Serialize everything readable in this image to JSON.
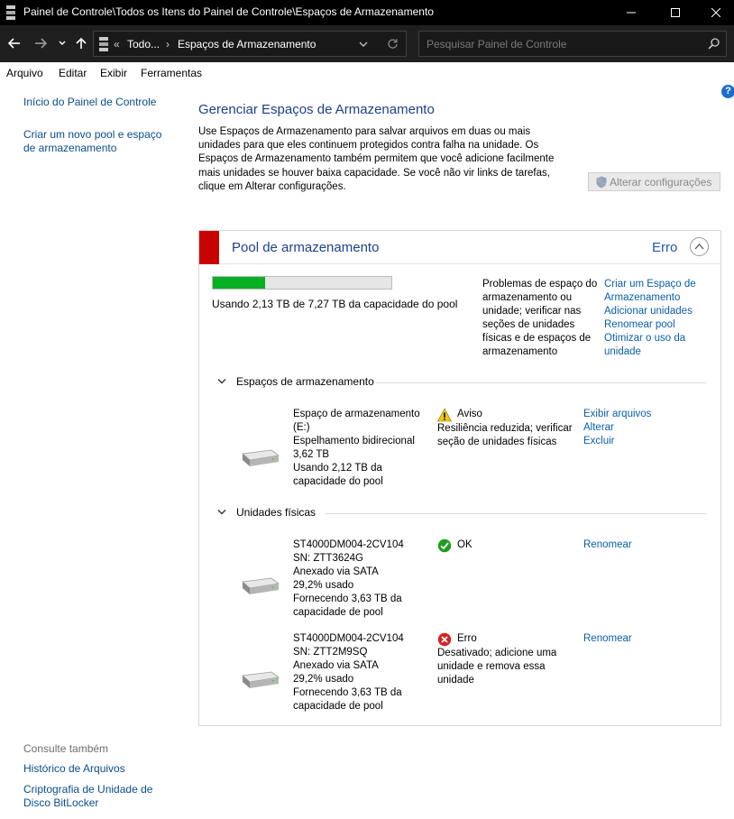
{
  "window": {
    "title": "Painel de Controle\\Todos os Itens do Painel de Controle\\Espaços de Armazenamento",
    "minimize": "—",
    "maximize": "☐",
    "close": "✕"
  },
  "address": {
    "overflow": "«",
    "crumb1": "Todo...",
    "separator": "›",
    "crumb2": "Espaços de Armazenamento",
    "search_placeholder": "Pesquisar Painel de Controle"
  },
  "menu": [
    "Arquivo",
    "Editar",
    "Exibir",
    "Ferramentas"
  ],
  "left_nav": {
    "home": "Início do Painel de Controle",
    "create_pool": "Criar um novo pool e espaço de armazenamento",
    "see_also_heading": "Consulte também",
    "file_history": "Histórico de Arquivos",
    "bitlocker": "Criptografia de Unidade de Disco BitLocker"
  },
  "main": {
    "title": "Gerenciar Espaços de Armazenamento",
    "description": "Use Espaços de Armazenamento para salvar arquivos em duas ou mais unidades para que eles continuem protegidos contra falha na unidade. Os Espaços de Armazenamento também permitem que você adicione facilmente mais unidades se houver baixa capacidade. Se você não vir links de tarefas, clique em Alterar configurações.",
    "change_settings": "Alterar configurações"
  },
  "pool": {
    "title": "Pool de armazenamento",
    "status": "Erro",
    "status_color": "#c80000",
    "usage_fraction": 0.293,
    "usage_text": "Usando 2,13 TB de 7,27 TB da capacidade do pool",
    "problems_text": "Problemas de espaço do armazenamento ou unidade; verificar nas seções de unidades físicas e de espaços de armazenamento",
    "tasks": [
      "Criar um Espaço de Armazenamento",
      "Adicionar unidades",
      "Renomear pool",
      "Otimizar o uso da unidade"
    ],
    "spaces_heading": "Espaços de armazenamento",
    "space": {
      "name": "Espaço de armazenamento (E:)",
      "resiliency": "Espelhamento bidirecional",
      "size": "3,62 TB",
      "usage": "Usando 2,12 TB da capacidade do pool",
      "status_label": "Aviso",
      "status_detail": "Resiliência reduzida; verificar seção de unidades físicas",
      "links": [
        "Exibir arquivos",
        "Alterar",
        "Excluir"
      ]
    },
    "drives_heading": "Unidades físicas",
    "drives": [
      {
        "model": "ST4000DM004-2CV104",
        "serial": "SN: ZTT3624G",
        "connection": "Anexado via SATA",
        "used": "29,2% usado",
        "provides": "Fornecendo 3,63 TB da capacidade de pool",
        "status_label": "OK",
        "status_detail": "",
        "link": "Renomear"
      },
      {
        "model": "ST4000DM004-2CV104",
        "serial": "SN: ZTT2M9SQ",
        "connection": "Anexado via SATA",
        "used": "29,2% usado",
        "provides": "Fornecendo 3,63 TB da capacidade de pool",
        "status_label": "Erro",
        "status_detail": "Desativado; adicione uma unidade e remova essa unidade",
        "link": "Renomear"
      }
    ]
  },
  "colors": {
    "accent_link": "#0a5ea8",
    "usage_fill": "#06b025",
    "error_red": "#c80000",
    "ok_green": "#1e9e1e",
    "warning_yellow": "#f2c811"
  },
  "icons": {
    "app": "storage-spaces-icon",
    "back": "arrow-left-icon",
    "forward": "arrow-right-icon",
    "recent": "chevron-down-icon",
    "up": "arrow-up-icon",
    "refresh": "refresh-icon",
    "search": "search-icon",
    "help": "help-icon",
    "shield": "shield-icon",
    "collapse": "chevron-up-icon",
    "drive": "hard-drive-icon",
    "warning": "warning-icon",
    "ok": "check-circle-icon",
    "error": "error-circle-icon"
  }
}
